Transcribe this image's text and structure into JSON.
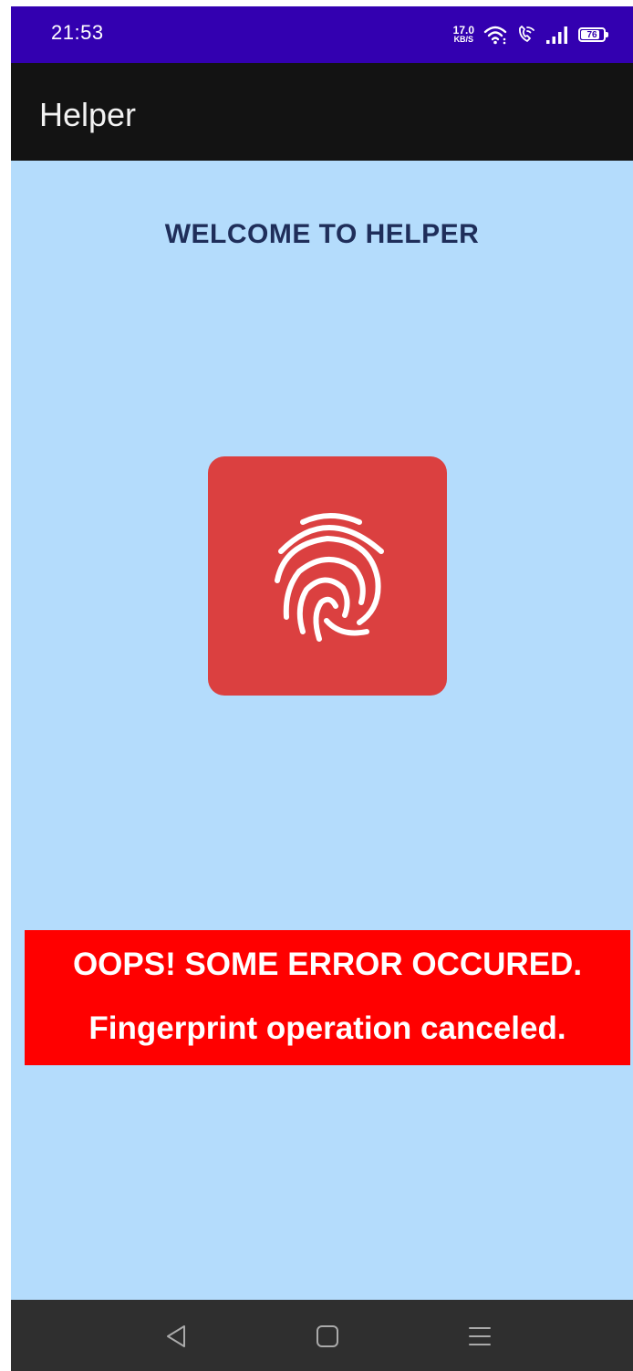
{
  "status_bar": {
    "time": "21:53",
    "net_speed_value": "17.0",
    "net_speed_unit": "KB/S",
    "battery_level": "76",
    "icons": [
      "wifi-icon",
      "wifi-calling-icon",
      "cell-signal-icon",
      "battery-icon"
    ],
    "background": "#3300b0"
  },
  "app_bar": {
    "title": "Helper",
    "background": "#131313"
  },
  "main": {
    "welcome_text": "WELCOME TO HELPER",
    "fingerprint_icon": "fingerprint-icon",
    "fingerprint_color": "#db4040",
    "background": "#b4dcfc"
  },
  "error": {
    "line1": "OOPS! SOME ERROR OCCURED.",
    "line2": "Fingerprint operation canceled.",
    "background": "#ff0000"
  },
  "nav_bar": {
    "icons": [
      "back-icon",
      "home-icon",
      "recents-icon"
    ]
  }
}
